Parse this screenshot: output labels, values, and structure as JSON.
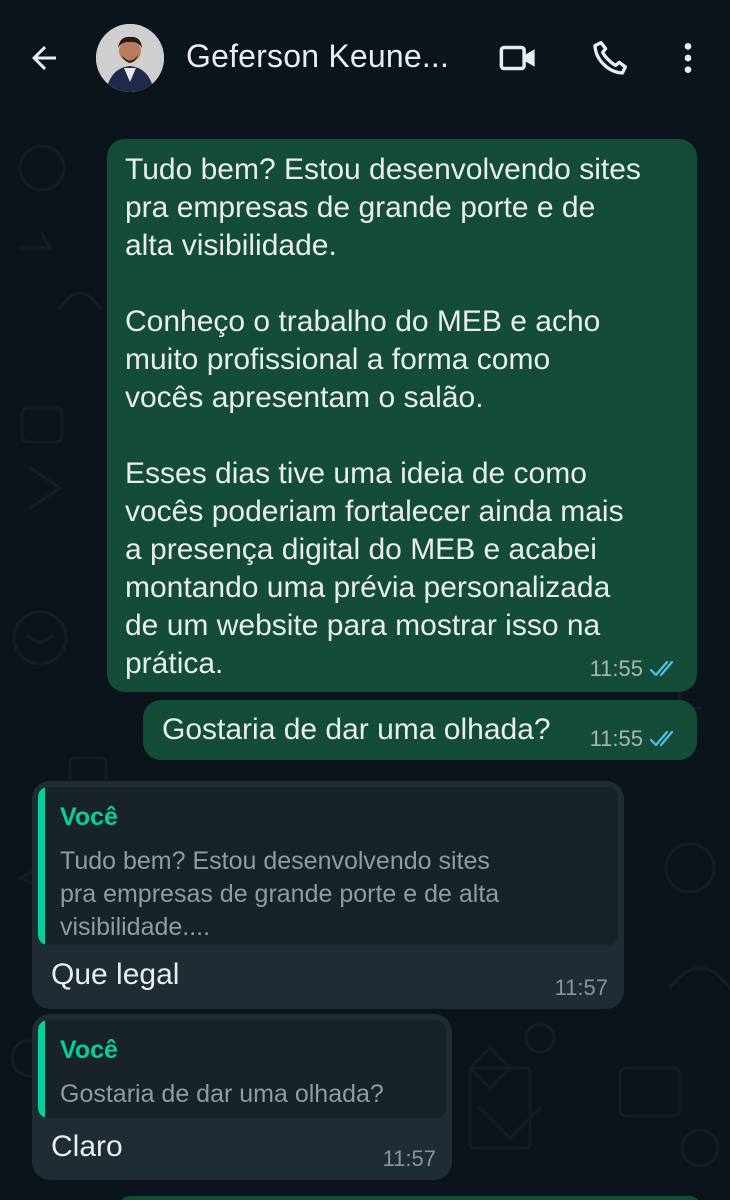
{
  "header": {
    "contact_name": "Geferson Keune...",
    "back_icon": "arrow-left-icon",
    "video_icon": "video-call-icon",
    "call_icon": "phone-icon",
    "menu_icon": "more-vert-icon"
  },
  "colors": {
    "background": "#0b141a",
    "outgoing_bubble": "#144d37",
    "incoming_bubble": "#1f2c34",
    "quote_accent": "#06cf9c",
    "read_ticks": "#53bdeb"
  },
  "messages": [
    {
      "direction": "outgoing",
      "text": "Tudo bem? Estou desenvolvendo sites\npra empresas de grande porte e de\nalta visibilidade.\n\nConheço o trabalho do MEB e acho\nmuito profissional a forma como\nvocês apresentam o salão.\n\nEsses dias tive uma ideia de como\nvocês poderiam fortalecer ainda mais\na presença digital do MEB e acabei\nmontando uma prévia personalizada\nde um website para mostrar isso na\nprática.",
      "time": "11:55",
      "status": "read"
    },
    {
      "direction": "outgoing",
      "text": "Gostaria de dar uma olhada?",
      "time": "11:55",
      "status": "read"
    },
    {
      "direction": "incoming",
      "quote_author": "Você",
      "quote_text": "Tudo bem? Estou desenvolvendo sites\npra empresas de grande porte e de alta\nvisibilidade....",
      "text": "Que legal",
      "time": "11:57"
    },
    {
      "direction": "incoming",
      "quote_author": "Você",
      "quote_text": "Gostaria de dar uma olhada?",
      "text": "Claro",
      "time": "11:57"
    }
  ]
}
